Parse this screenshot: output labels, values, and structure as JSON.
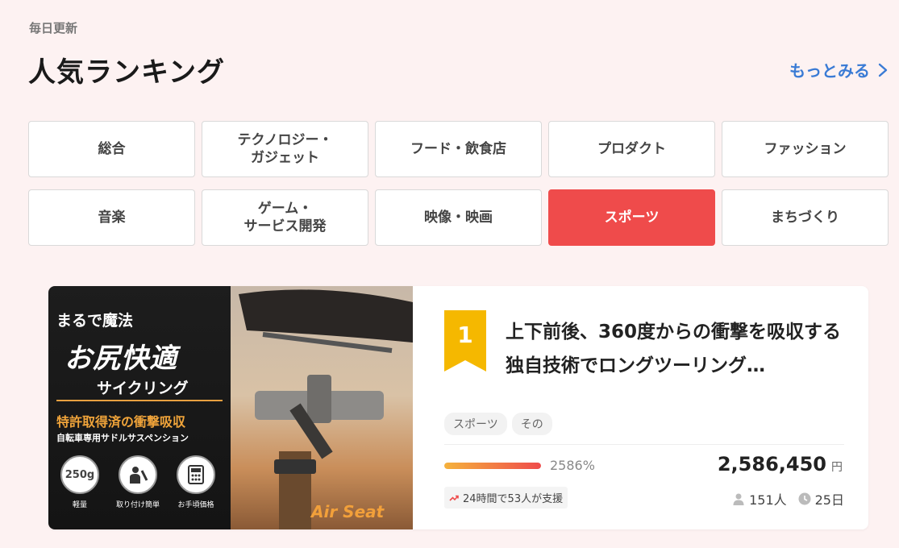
{
  "header": {
    "eyebrow": "毎日更新",
    "title": "人気ランキング",
    "more_label": "もっとみる"
  },
  "categories": [
    {
      "label": "総合",
      "active": false
    },
    {
      "label": "テクノロジー・\nガジェット",
      "active": false
    },
    {
      "label": "フード・飲食店",
      "active": false
    },
    {
      "label": "プロダクト",
      "active": false
    },
    {
      "label": "ファッション",
      "active": false
    },
    {
      "label": "音楽",
      "active": false
    },
    {
      "label": "ゲーム・\nサービス開発",
      "active": false
    },
    {
      "label": "映像・映画",
      "active": false
    },
    {
      "label": "スポーツ",
      "active": true
    },
    {
      "label": "まちづくり",
      "active": false
    }
  ],
  "colors": {
    "accent": "#ef4b4b",
    "link": "#3a7bd5",
    "rank_badge": "#f5b800",
    "background": "#fdf2f2"
  },
  "project": {
    "rank": "1",
    "title": "上下前後、360度からの衝撃を吸収する独自技術でロングツーリング…",
    "tags": [
      "スポーツ",
      "その"
    ],
    "progress_percent": 2586,
    "progress_label": "2586%",
    "amount": "2,586,450",
    "currency": "円",
    "trend_text": "24時間で53人が支援",
    "supporters": "151人",
    "days_left": "25日",
    "thumbnail": {
      "line1": "まるで魔法",
      "line2": "お尻快適",
      "line3": "サイクリング",
      "line4": "特許取得済の衝撃吸収",
      "line5": "自転車専用サドルサスペンション",
      "features": [
        {
          "icon": "feather-icon",
          "text": "250g",
          "label": "軽量"
        },
        {
          "icon": "wrench-person-icon",
          "text": "",
          "label": "取り付け簡単"
        },
        {
          "icon": "calculator-icon",
          "text": "",
          "label": "お手頃価格"
        }
      ],
      "brand": "Air Seat"
    }
  }
}
